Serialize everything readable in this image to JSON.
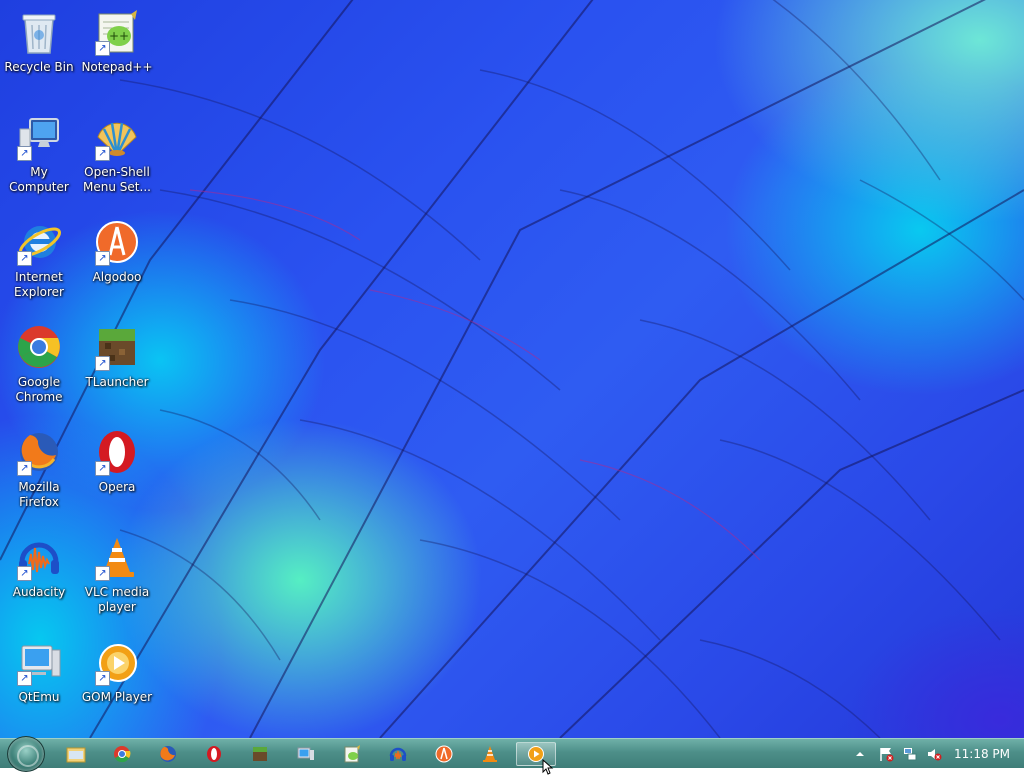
{
  "desktop": {
    "icons": [
      {
        "label": "Recycle Bin",
        "icon": "recycle-bin-icon",
        "shortcut": false
      },
      {
        "label": "Notepad++",
        "icon": "notepad-plus-plus-icon",
        "shortcut": true
      },
      {
        "label": "My Computer",
        "icon": "computer-icon",
        "shortcut": true
      },
      {
        "label": "Open-Shell Menu Set...",
        "icon": "open-shell-icon",
        "shortcut": true
      },
      {
        "label": "Internet Explorer",
        "icon": "internet-explorer-icon",
        "shortcut": true
      },
      {
        "label": "Algodoo",
        "icon": "algodoo-icon",
        "shortcut": true
      },
      {
        "label": "Google Chrome",
        "icon": "chrome-icon",
        "shortcut": true
      },
      {
        "label": "TLauncher",
        "icon": "tlauncher-icon",
        "shortcut": true
      },
      {
        "label": "Mozilla Firefox",
        "icon": "firefox-icon",
        "shortcut": true
      },
      {
        "label": "Opera",
        "icon": "opera-icon",
        "shortcut": true
      },
      {
        "label": "Audacity",
        "icon": "audacity-icon",
        "shortcut": true
      },
      {
        "label": "VLC media player",
        "icon": "vlc-icon",
        "shortcut": true
      },
      {
        "label": "QtEmu",
        "icon": "qtemu-icon",
        "shortcut": true
      },
      {
        "label": "GOM Player",
        "icon": "gom-player-icon",
        "shortcut": true
      }
    ]
  },
  "taskbar": {
    "start_button": "start-orb-icon",
    "pinned": [
      "file-explorer-icon",
      "chrome-icon",
      "firefox-icon",
      "opera-icon",
      "tlauncher-icon",
      "qtemu-icon",
      "notepad-plus-plus-icon",
      "audacity-icon",
      "algodoo-icon",
      "vlc-icon",
      "gom-player-icon"
    ],
    "active_item": "gom-player-icon",
    "tray": {
      "icons": [
        "show-hidden-icons-chevron",
        "action-center-flag-icon",
        "network-icon",
        "volume-muted-icon"
      ],
      "clock": "11:18 PM"
    }
  },
  "colors": {
    "taskbar": "#4d8f89",
    "wallpaper_blue": "#2a52f0",
    "wallpaper_cyan": "#00e6f0",
    "wallpaper_green": "#5affbe"
  }
}
